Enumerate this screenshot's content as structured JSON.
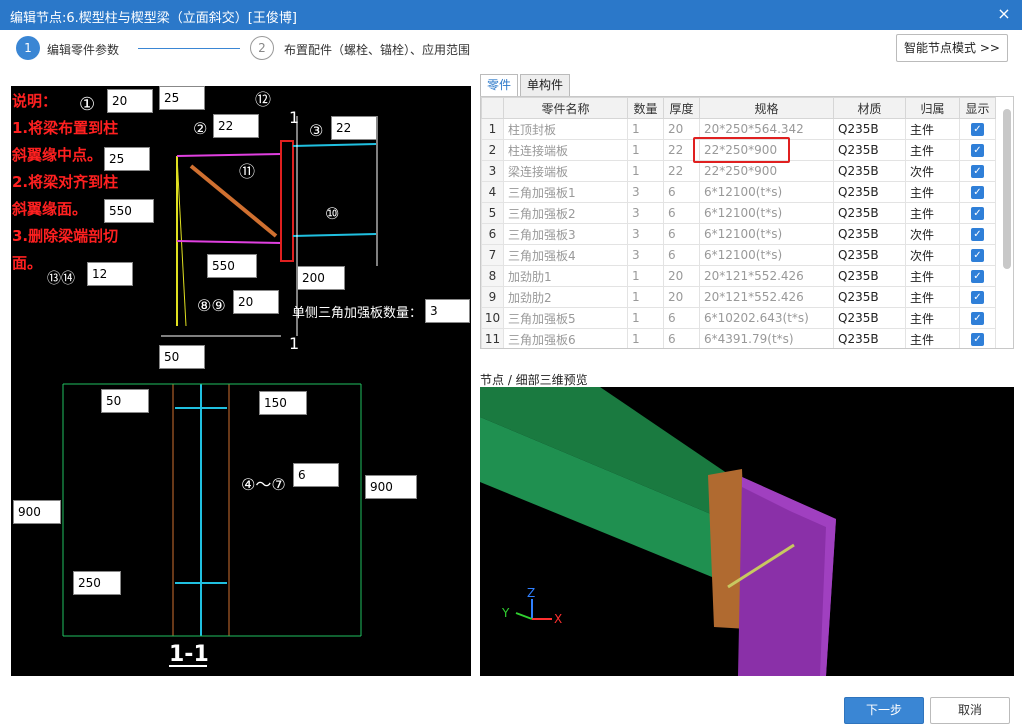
{
  "window": {
    "title": "编辑节点:6.楔型柱与楔型梁（立面斜交）[王俊博]",
    "close_glyph": "×"
  },
  "steps": [
    {
      "number": "1",
      "label": "编辑零件参数"
    },
    {
      "number": "2",
      "label": "布置配件（螺栓、锚栓）、应用范围"
    }
  ],
  "smart_mode_button": "智能节点模式 >>",
  "cad": {
    "notes": [
      "说明：",
      "1.将梁布置到柱",
      "斜翼缘中点。",
      "2.将梁对齐到柱",
      "斜翼缘面。",
      "3.删除梁端剖切",
      "面。"
    ],
    "dims": {
      "d1": "20",
      "d2": "25",
      "d3": "22",
      "d4": "22",
      "d5": "25",
      "d6": "550",
      "d7": "12",
      "d8": "550",
      "d9": "20",
      "d10": "200",
      "d11": "3",
      "d12": "50",
      "d13": "50",
      "d14": "150",
      "d15": "6",
      "d16": "900",
      "d17": "900",
      "d18": "250"
    },
    "labels": {
      "c1": "①",
      "c2": "②",
      "c3": "③",
      "c10": "⑩",
      "c11": "⑪",
      "c12": "⑫",
      "c1314": "⑬⑭",
      "c89": "⑧⑨",
      "c47": "④～⑦",
      "triangle_count": "单侧三角加强板数量：",
      "section_mark": "1",
      "section_title": "1-1"
    }
  },
  "tabs": [
    {
      "label": "零件",
      "active": true
    },
    {
      "label": "单构件",
      "active": false
    }
  ],
  "table": {
    "columns": [
      "",
      "零件名称",
      "数量",
      "厚度",
      "规格",
      "材质",
      "归属",
      "显示"
    ],
    "rows": [
      {
        "no": "1",
        "name": "柱顶封板",
        "qty": "1",
        "thk": "20",
        "spec": "20*250*564.342",
        "mat": "Q235B",
        "owner": "主件",
        "show": true
      },
      {
        "no": "2",
        "name": "柱连接端板",
        "qty": "1",
        "thk": "22",
        "spec": "22*250*900",
        "mat": "Q235B",
        "owner": "主件",
        "show": true
      },
      {
        "no": "3",
        "name": "梁连接端板",
        "qty": "1",
        "thk": "22",
        "spec": "22*250*900",
        "mat": "Q235B",
        "owner": "次件",
        "show": true
      },
      {
        "no": "4",
        "name": "三角加强板1",
        "qty": "3",
        "thk": "6",
        "spec": "6*12100(t*s)",
        "mat": "Q235B",
        "owner": "主件",
        "show": true
      },
      {
        "no": "5",
        "name": "三角加强板2",
        "qty": "3",
        "thk": "6",
        "spec": "6*12100(t*s)",
        "mat": "Q235B",
        "owner": "主件",
        "show": true
      },
      {
        "no": "6",
        "name": "三角加强板3",
        "qty": "3",
        "thk": "6",
        "spec": "6*12100(t*s)",
        "mat": "Q235B",
        "owner": "次件",
        "show": true
      },
      {
        "no": "7",
        "name": "三角加强板4",
        "qty": "3",
        "thk": "6",
        "spec": "6*12100(t*s)",
        "mat": "Q235B",
        "owner": "次件",
        "show": true
      },
      {
        "no": "8",
        "name": "加劲肋1",
        "qty": "1",
        "thk": "20",
        "spec": "20*121*552.426",
        "mat": "Q235B",
        "owner": "主件",
        "show": true
      },
      {
        "no": "9",
        "name": "加劲肋2",
        "qty": "1",
        "thk": "20",
        "spec": "20*121*552.426",
        "mat": "Q235B",
        "owner": "主件",
        "show": true
      },
      {
        "no": "10",
        "name": "三角加强板5",
        "qty": "1",
        "thk": "6",
        "spec": "6*10202.643(t*s)",
        "mat": "Q235B",
        "owner": "主件",
        "show": true
      },
      {
        "no": "11",
        "name": "三角加强板6",
        "qty": "1",
        "thk": "6",
        "spec": "6*4391.79(t*s)",
        "mat": "Q235B",
        "owner": "主件",
        "show": true
      }
    ]
  },
  "preview": {
    "title": "节点 / 细部三维预览",
    "axis_x": "X",
    "axis_y": "Y",
    "axis_z": "Z"
  },
  "buttons": {
    "next": "下一步",
    "cancel": "取消"
  }
}
